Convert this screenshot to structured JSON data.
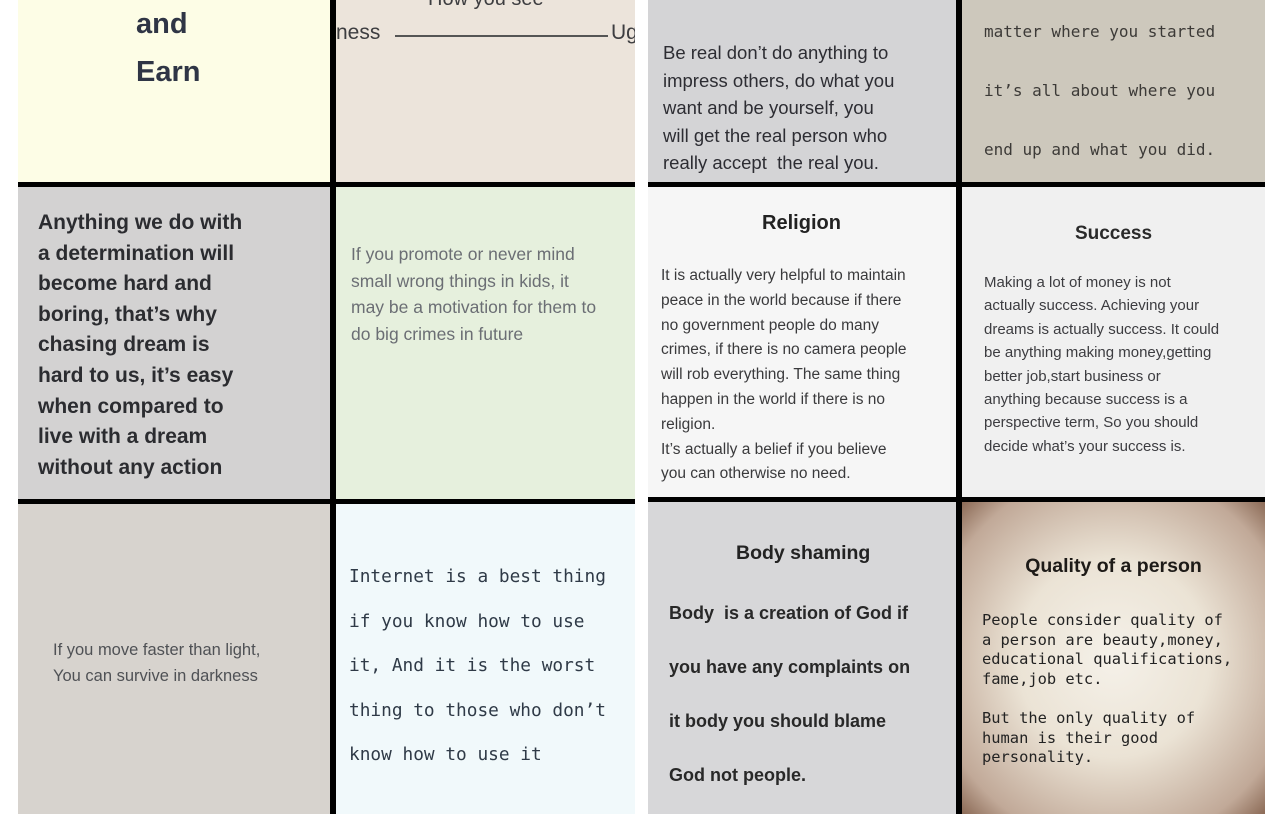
{
  "left_panel": {
    "and_earn": "and\nEarn",
    "how_you_see": {
      "top_text": "How you see",
      "left_label": "ness",
      "right_label": "Ug"
    },
    "determination": "Anything we do with\na determination will\nbecome hard and\nboring, that’s why\nchasing dream is\nhard to us, it’s easy\nwhen compared to\nlive with a dream\nwithout any action",
    "kids": "If you promote or never mind\nsmall wrong things in kids, it\nmay be a motivation for them to\ndo big crimes in future",
    "light": "If you move faster than light,\nYou can survive in darkness",
    "internet": "Internet is a best thing\nif you know how to use\nit, And it is the worst\nthing to those who don’t\nknow how to use it"
  },
  "right_panel": {
    "be_real": "Be real don’t do anything to\nimpress others, do what you\nwant and be yourself, you\nwill get the real person who\nreally accept  the real you.",
    "matter": "matter where you started\nit’s all about where you\nend up and what you did.",
    "religion": {
      "title": "Religion",
      "body": "It is actually very helpful to maintain\npeace in the world because if there\nno government people do many\ncrimes, if there is no camera people\nwill rob everything. The same thing\nhappen in the world if there is no\nreligion.\nIt’s actually a belief if you believe\nyou can otherwise no need."
    },
    "success": {
      "title": "Success",
      "body": "Making a lot of money is not\nactually success. Achieving your\ndreams is actually success. It could\nbe anything making money,getting\nbetter job,start business or\nanything because success is a\nperspective term, So you should\ndecide what’s your success is."
    },
    "body_shaming": {
      "title": "Body shaming",
      "body": "Body  is a creation of God if\nyou have any complaints on\nit body you should blame\nGod not people."
    },
    "quality": {
      "title": "Quality of a person",
      "body": "People consider quality of\na person are beauty,money,\neducational qualifications,\nfame,job etc.\n\nBut the only quality of\nhuman is their good\npersonality."
    }
  }
}
